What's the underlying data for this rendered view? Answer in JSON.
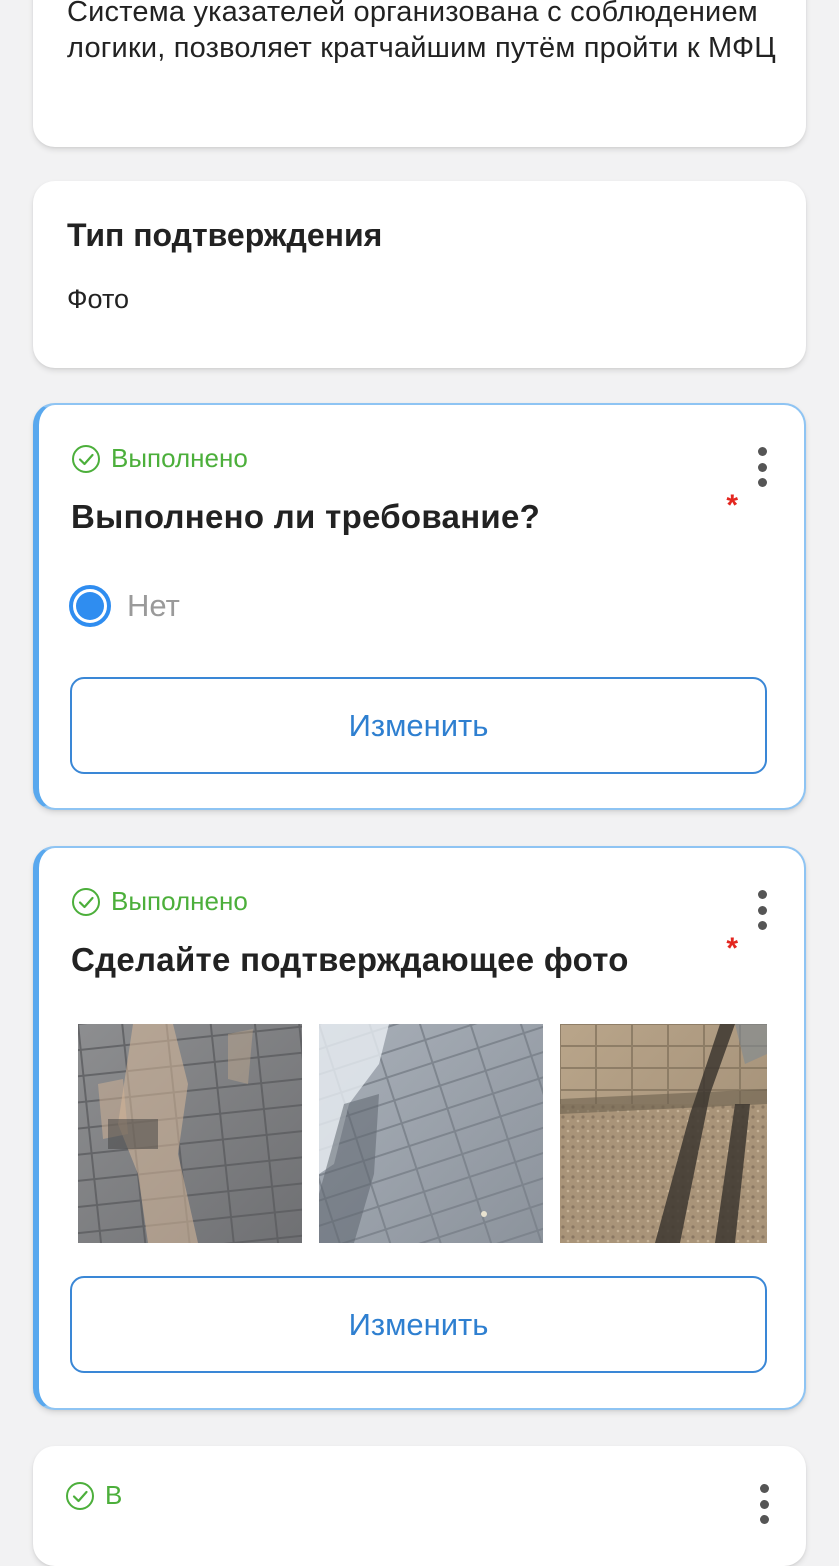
{
  "description_card": {
    "text": "Система указателей организована с соблюдением логики, позволяет кратчайшим путём пройти к МФЦ"
  },
  "confirmation_type_card": {
    "title": "Тип подтверждения",
    "value": "Фото"
  },
  "question_cards": [
    {
      "status": "Выполнено",
      "question": "Выполнено ли требование?",
      "required_mark": "*",
      "selected_option": "Нет",
      "change_button": "Изменить"
    },
    {
      "status": "Выполнено",
      "question": "Сделайте подтверждающее фото",
      "required_mark": "*",
      "photos": [
        "paving-tiles-with-shadow-1",
        "paving-tiles-with-shadow-2",
        "paving-curb-with-shadow-3"
      ],
      "change_button": "Изменить"
    }
  ],
  "next_card": {
    "status_partial": "В"
  },
  "colors": {
    "accent_blue": "#2f8df0",
    "status_green": "#4caf3b",
    "required_red": "#e3261f",
    "active_border": "#59a8ee"
  }
}
